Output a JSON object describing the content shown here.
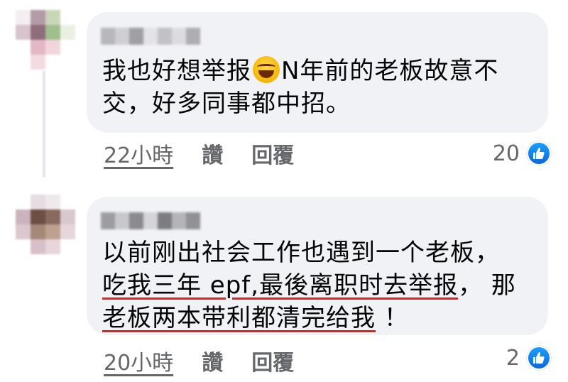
{
  "comments": [
    {
      "text_lines": [
        "我也好想举报",
        "N年前的老板故意不",
        "交，好多同事都中招。"
      ],
      "emoji": "crying-laughing-face",
      "time": "22小時",
      "like_action": "讚",
      "reply_action": "回覆",
      "like_count": "20"
    },
    {
      "text_lines": [
        "以前刚出社会工作也遇到一个老板，",
        "吃我三年 epf,最後离职时去举报",
        "， 那",
        "老板两本带利都清完给我",
        "！"
      ],
      "time": "20小時",
      "like_action": "讚",
      "reply_action": "回覆",
      "like_count": "2"
    }
  ],
  "colors": {
    "bubble": "#f0f2f5",
    "secondary_text": "#65676b",
    "like_blue": "#1877f2",
    "underline_red": "#e02020"
  }
}
